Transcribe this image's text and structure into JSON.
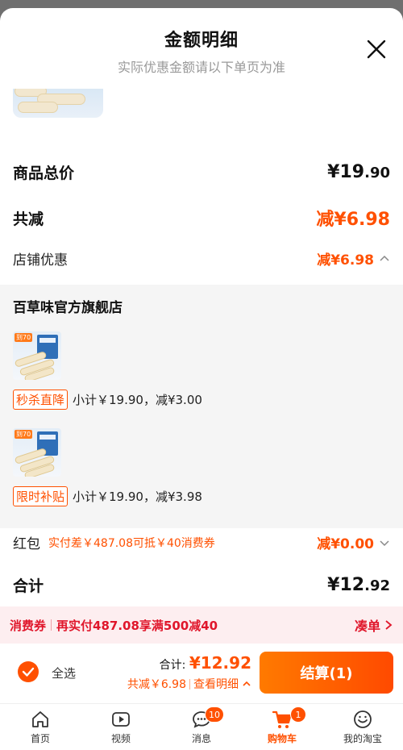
{
  "header": {
    "title": "金额明细",
    "subtitle": "实际优惠金额请以下单页为准"
  },
  "summary": {
    "total_label": "商品总价",
    "total_main": "¥19",
    "total_dec": ".90",
    "discount_label": "共减",
    "discount_value": "减¥6.98",
    "shop_discount_label": "店铺优惠",
    "shop_discount_value": "减¥6.98"
  },
  "shop": {
    "name": "百草味官方旗舰店",
    "products": [
      {
        "tag": "秒杀直降",
        "text": "小计￥19.90，减¥3.00",
        "img_badge": "到70"
      },
      {
        "tag": "限时补贴",
        "text": "小计￥19.90，减¥3.98",
        "img_badge": "到70"
      }
    ]
  },
  "hongbao": {
    "label": "红包",
    "note": "实付差￥487.08可抵￥40消费券",
    "value": "减¥0.00"
  },
  "grand_total": {
    "label": "合计",
    "main": "¥12",
    "dec": ".92"
  },
  "coupon_bar": {
    "left_a": "消费券",
    "left_b": "再实付487.08享满500减40",
    "right": "凑单"
  },
  "checkout": {
    "select_all": "全选",
    "sum_prefix": "合计: ",
    "sum_value": "¥12.92",
    "saved": "共减￥6.98",
    "view_detail": "查看明细",
    "pay_button": "结算(1)"
  },
  "tabbar": {
    "items": [
      {
        "label": "首页",
        "icon": "home-icon"
      },
      {
        "label": "视频",
        "icon": "video-icon"
      },
      {
        "label": "消息",
        "icon": "message-icon",
        "badge": "10"
      },
      {
        "label": "购物车",
        "icon": "cart-icon",
        "badge": "1"
      },
      {
        "label": "我的淘宝",
        "icon": "profile-icon"
      }
    ]
  },
  "colors": {
    "accent": "#ff5000",
    "coupon_red": "#e0162b",
    "coupon_bg": "#fdeef0"
  }
}
